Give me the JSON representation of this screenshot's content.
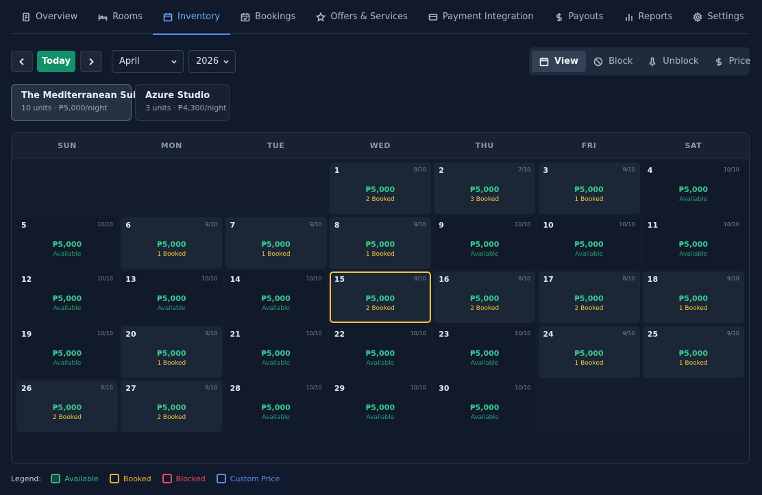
{
  "tabs": [
    {
      "label": "Overview",
      "icon": "document-icon",
      "active": false
    },
    {
      "label": "Rooms",
      "icon": "bed-icon",
      "active": false
    },
    {
      "label": "Inventory",
      "icon": "calendar-icon",
      "active": true
    },
    {
      "label": "Bookings",
      "icon": "calendar-check-icon",
      "active": false
    },
    {
      "label": "Offers & Services",
      "icon": "star-icon",
      "active": false
    },
    {
      "label": "Payment Integration",
      "icon": "credit-card-icon",
      "active": false
    },
    {
      "label": "Payouts",
      "icon": "dollar-icon",
      "active": false
    },
    {
      "label": "Reports",
      "icon": "bar-chart-icon",
      "active": false
    },
    {
      "label": "Settings",
      "icon": "gear-icon",
      "active": false
    }
  ],
  "toolbar": {
    "today_label": "Today",
    "month": "April",
    "year": "2026",
    "actions": [
      {
        "label": "View",
        "icon": "calendar-icon",
        "active": true
      },
      {
        "label": "Block",
        "icon": "ban-icon",
        "active": false
      },
      {
        "label": "Unblock",
        "icon": "unlock-icon",
        "active": false
      },
      {
        "label": "Price",
        "icon": "dollar-icon",
        "active": false
      }
    ]
  },
  "rooms": [
    {
      "name": "The Mediterranean Suite",
      "details": "10 units · ₱5,000/night",
      "active": true
    },
    {
      "name": "Azure Studio",
      "details": "3 units · ₱4,300/night",
      "active": false
    }
  ],
  "weekdays": [
    "SUN",
    "MON",
    "TUE",
    "WED",
    "THU",
    "FRI",
    "SAT"
  ],
  "calendar": {
    "first_weekday": 3,
    "selected_day": 15,
    "days": [
      {
        "day": "1",
        "occupancy": "8/10",
        "price": "₱5,000",
        "status": "2 Booked"
      },
      {
        "day": "2",
        "occupancy": "7/10",
        "price": "₱5,000",
        "status": "3 Booked"
      },
      {
        "day": "3",
        "occupancy": "9/10",
        "price": "₱5,000",
        "status": "1 Booked"
      },
      {
        "day": "4",
        "occupancy": "10/10",
        "price": "₱5,000",
        "status": "Available"
      },
      {
        "day": "5",
        "occupancy": "10/10",
        "price": "₱5,000",
        "status": "Available"
      },
      {
        "day": "6",
        "occupancy": "9/10",
        "price": "₱5,000",
        "status": "1 Booked"
      },
      {
        "day": "7",
        "occupancy": "9/10",
        "price": "₱5,000",
        "status": "1 Booked"
      },
      {
        "day": "8",
        "occupancy": "9/10",
        "price": "₱5,000",
        "status": "1 Booked"
      },
      {
        "day": "9",
        "occupancy": "10/10",
        "price": "₱5,000",
        "status": "Available"
      },
      {
        "day": "10",
        "occupancy": "10/10",
        "price": "₱5,000",
        "status": "Available"
      },
      {
        "day": "11",
        "occupancy": "10/10",
        "price": "₱5,000",
        "status": "Available"
      },
      {
        "day": "12",
        "occupancy": "10/10",
        "price": "₱5,000",
        "status": "Available"
      },
      {
        "day": "13",
        "occupancy": "10/10",
        "price": "₱5,000",
        "status": "Available"
      },
      {
        "day": "14",
        "occupancy": "10/10",
        "price": "₱5,000",
        "status": "Available"
      },
      {
        "day": "15",
        "occupancy": "8/10",
        "price": "₱5,000",
        "status": "2 Booked"
      },
      {
        "day": "16",
        "occupancy": "8/10",
        "price": "₱5,000",
        "status": "2 Booked"
      },
      {
        "day": "17",
        "occupancy": "8/10",
        "price": "₱5,000",
        "status": "2 Booked"
      },
      {
        "day": "18",
        "occupancy": "9/10",
        "price": "₱5,000",
        "status": "1 Booked"
      },
      {
        "day": "19",
        "occupancy": "10/10",
        "price": "₱5,000",
        "status": "Available"
      },
      {
        "day": "20",
        "occupancy": "9/10",
        "price": "₱5,000",
        "status": "1 Booked"
      },
      {
        "day": "21",
        "occupancy": "10/10",
        "price": "₱5,000",
        "status": "Available"
      },
      {
        "day": "22",
        "occupancy": "10/10",
        "price": "₱5,000",
        "status": "Available"
      },
      {
        "day": "23",
        "occupancy": "10/10",
        "price": "₱5,000",
        "status": "Available"
      },
      {
        "day": "24",
        "occupancy": "9/10",
        "price": "₱5,000",
        "status": "1 Booked"
      },
      {
        "day": "25",
        "occupancy": "9/10",
        "price": "₱5,000",
        "status": "1 Booked"
      },
      {
        "day": "26",
        "occupancy": "8/10",
        "price": "₱5,000",
        "status": "2 Booked"
      },
      {
        "day": "27",
        "occupancy": "8/10",
        "price": "₱5,000",
        "status": "2 Booked"
      },
      {
        "day": "28",
        "occupancy": "10/10",
        "price": "₱5,000",
        "status": "Available"
      },
      {
        "day": "29",
        "occupancy": "10/10",
        "price": "₱5,000",
        "status": "Available"
      },
      {
        "day": "30",
        "occupancy": "10/10",
        "price": "₱5,000",
        "status": "Available"
      }
    ]
  },
  "legend": {
    "title": "Legend:",
    "items": [
      {
        "label": "Available",
        "color": "#2fb985",
        "fill": "#1a4a3c"
      },
      {
        "label": "Booked",
        "color": "#f0b429",
        "fill": "transparent"
      },
      {
        "label": "Blocked",
        "color": "#ef4d5a",
        "fill": "transparent"
      },
      {
        "label": "Custom Price",
        "color": "#5b8def",
        "fill": "transparent"
      }
    ]
  }
}
